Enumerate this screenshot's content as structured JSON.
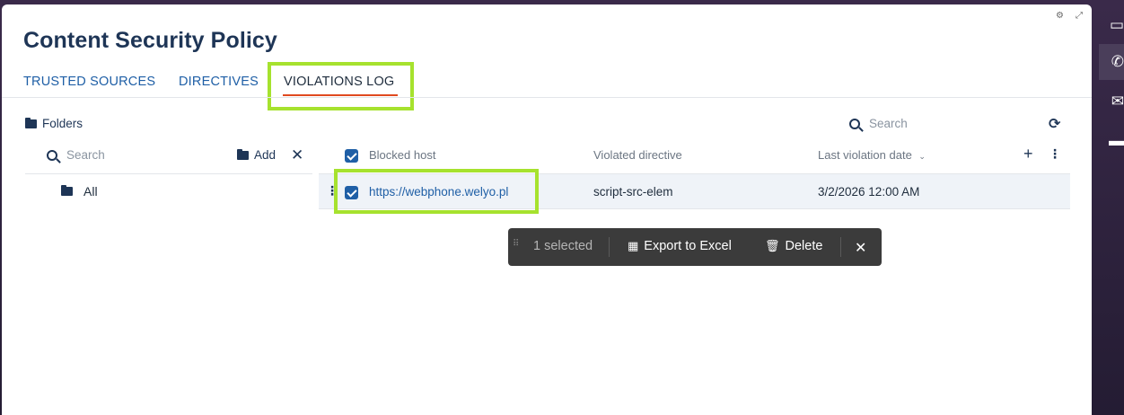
{
  "page": {
    "title": "Content Security Policy"
  },
  "tabs": [
    {
      "label": "TRUSTED SOURCES",
      "active": false
    },
    {
      "label": "DIRECTIVES",
      "active": false
    },
    {
      "label": "VIOLATIONS LOG",
      "active": true
    }
  ],
  "folders": {
    "header": "Folders",
    "search_placeholder": "Search",
    "add_label": "Add",
    "items": [
      {
        "label": "All"
      }
    ]
  },
  "grid": {
    "search_placeholder": "Search",
    "columns": [
      {
        "label": "Blocked host"
      },
      {
        "label": "Violated directive"
      },
      {
        "label": "Last violation date",
        "sorted": "desc"
      }
    ],
    "rows": [
      {
        "blocked_host": "https://webphone.welyo.pl",
        "violated_directive": "script-src-elem",
        "last_violation_date": "3/2/2026 12:00 AM",
        "selected": true
      }
    ]
  },
  "selection_toolbar": {
    "count_label": "1 selected",
    "export_label": "Export to Excel",
    "delete_label": "Delete"
  },
  "colors": {
    "accent": "#1f5fa6",
    "title": "#1e3556",
    "active_tab_underline": "#e04a1f",
    "highlight": "#a6e22e",
    "toolbar_bg": "#3b3b3b"
  },
  "icons": {
    "folder": "folder-icon",
    "search": "search-icon",
    "add": "folder-plus-icon",
    "close": "close-icon",
    "refresh": "refresh-icon",
    "export": "excel-icon",
    "delete": "trash-icon"
  }
}
